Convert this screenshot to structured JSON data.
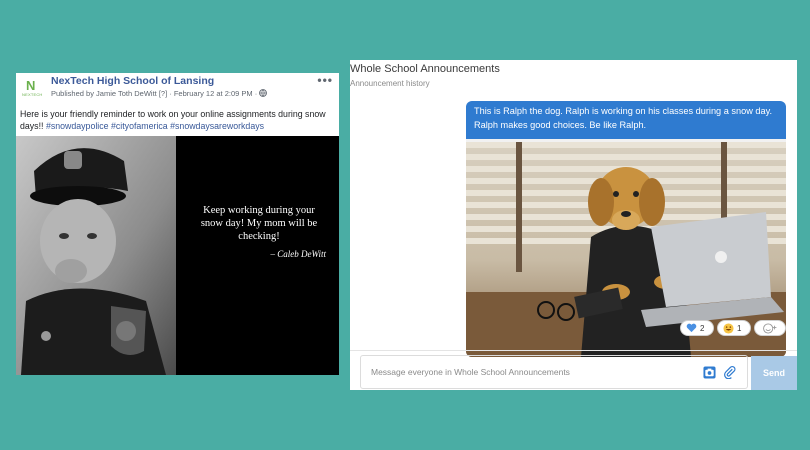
{
  "facebook_post": {
    "page_name": "NexTech High School of Lansing",
    "logo_text": "NEXTECH",
    "meta": "Published by Jamie Toth DeWitt [?] · February 12 at 2:09 PM ·",
    "body_text": "Here is your friendly reminder to work on your online assignments during snow days!!",
    "hashtags": "#snowdaypolice #cityofamerica #snowdaysareworkdays",
    "quote": "Keep working during your snow day! My mom will be checking!",
    "quote_author": "– Caleb DeWitt"
  },
  "announcements": {
    "title": "Whole School Announcements",
    "subtitle": "Announcement history",
    "message": "This is Ralph the dog. Ralph is working on his classes during a snow day. Ralph makes good choices. Be like Ralph.",
    "reactions": [
      {
        "icon": "heart-icon",
        "count": "2"
      },
      {
        "icon": "laugh-emoji-icon",
        "count": "1"
      }
    ],
    "composer_placeholder": "Message everyone in Whole School Announcements",
    "send_label": "Send"
  }
}
